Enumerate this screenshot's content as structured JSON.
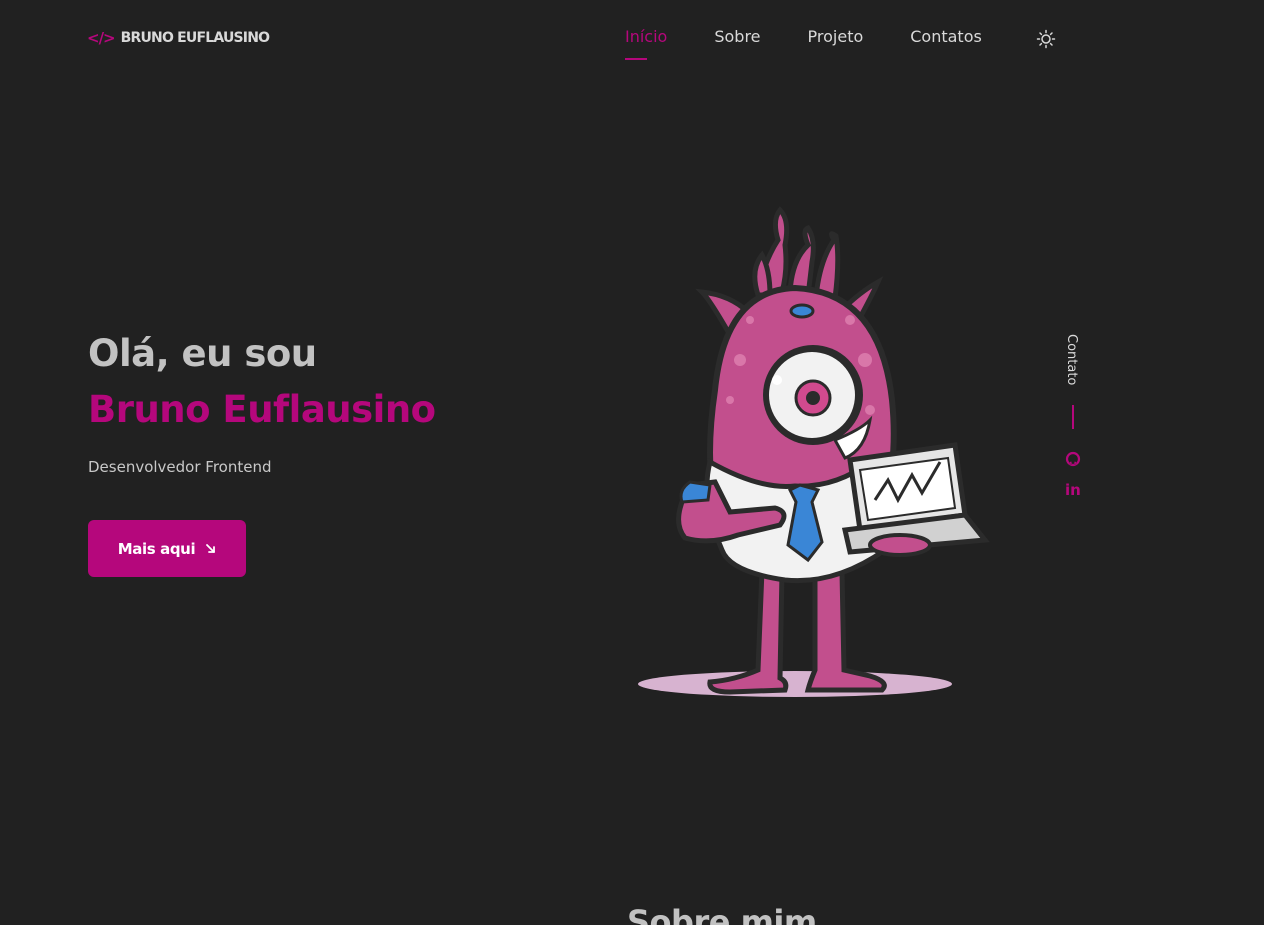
{
  "header": {
    "logo_icon": "</>",
    "logo_text": "BRUNO EUFLAUSINO",
    "nav": [
      {
        "label": "Início",
        "active": true
      },
      {
        "label": "Sobre",
        "active": false
      },
      {
        "label": "Projeto",
        "active": false
      },
      {
        "label": "Contatos",
        "active": false
      }
    ],
    "theme_icon": "sun-icon"
  },
  "hero": {
    "greeting": "Olá, eu sou",
    "name": "Bruno Euflausino",
    "role": "Desenvolvedor Frontend",
    "button_label": "Mais aqui",
    "button_icon": "arrow-down-right-icon",
    "illustration": "pink-monster-with-laptop"
  },
  "social": {
    "label": "Contato",
    "github_icon": "github-icon",
    "linkedin_text": "in"
  },
  "next_section": {
    "title": "Sobre mim"
  },
  "colors": {
    "background": "#212121",
    "accent": "#b5077c",
    "text": "#d9d9d9"
  }
}
